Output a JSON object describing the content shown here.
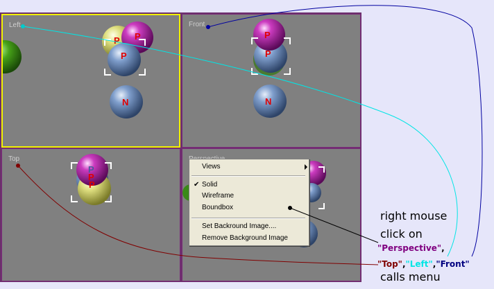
{
  "viewports": {
    "left": {
      "label": "Left"
    },
    "front": {
      "label": "Front"
    },
    "top": {
      "label": "Top"
    },
    "perspective": {
      "label": "Perspective"
    }
  },
  "atoms": {
    "proton": "P",
    "neutron": "N"
  },
  "context_menu": {
    "views": "Views",
    "solid": "Solid",
    "wireframe": "Wireframe",
    "boundbox": "Boundbox",
    "set_background": "Set Backround Image....",
    "remove_background": "Remove Background Image",
    "checkmark": "✔"
  },
  "annotation": {
    "line1": "right mouse",
    "line2": "click on",
    "perspective": "\"Perspective\"",
    "comma1": ",",
    "top": "\"Top\"",
    "comma2": ",",
    "left": "\"Left\"",
    "comma3": ",",
    "front": "\"Front\"",
    "line4": "calls menu"
  },
  "colors": {
    "background": "#E6E6FA",
    "viewport": "#808080",
    "active_border": "#F2F200",
    "perspective_text": "#800080",
    "top_text": "#800000",
    "left_text": "#00FFFF",
    "front_text": "#000080"
  }
}
